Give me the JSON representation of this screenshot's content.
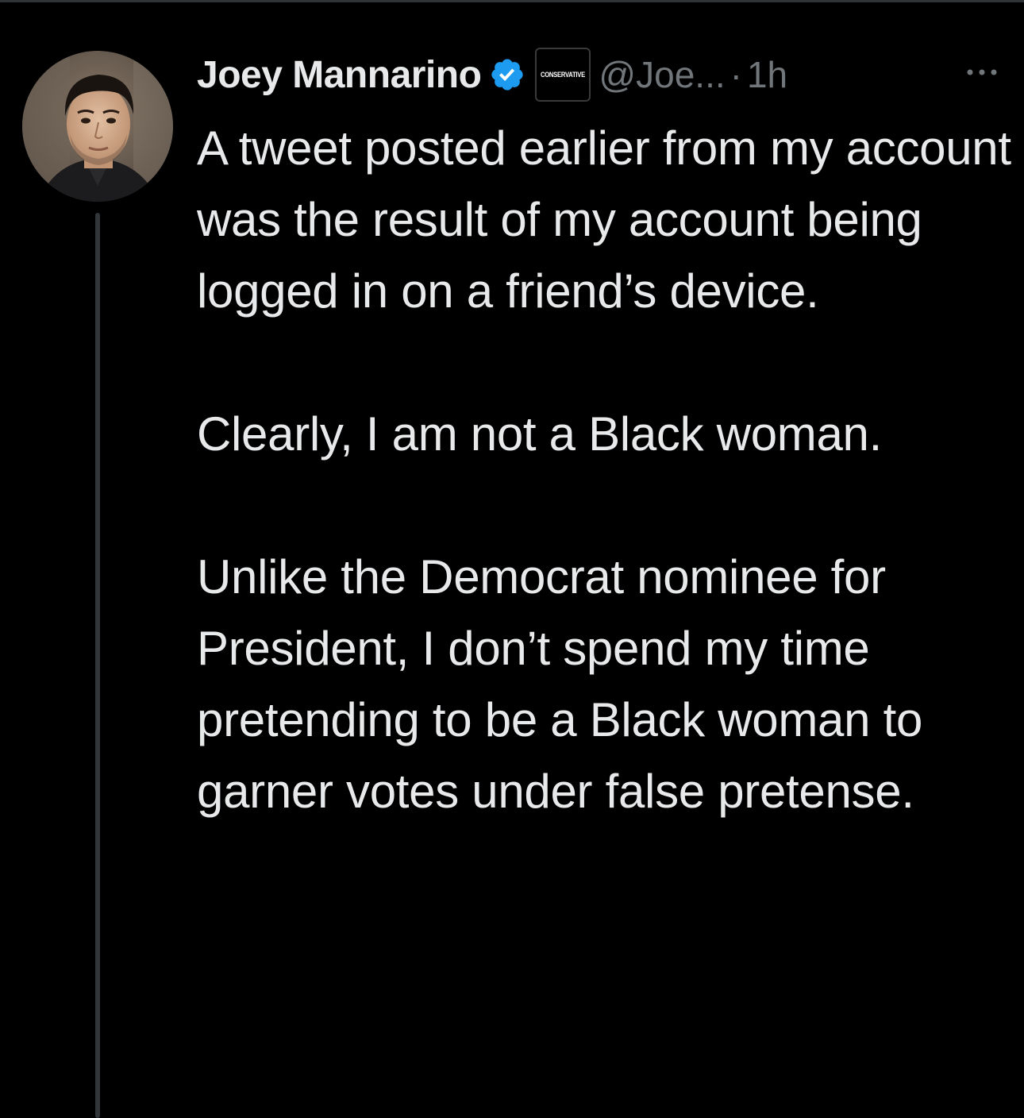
{
  "tweet": {
    "display_name": "Joey Mannarino",
    "affiliation_badge": "CONSERVATIVE",
    "handle": "@Joe...",
    "separator": "·",
    "timestamp": "1h",
    "paragraphs": [
      "A tweet posted earlier from my account was the result of my account being logged in on a friend’s device.",
      "Clearly, I am not a Black woman.",
      "Unlike the Democrat nominee for President, I don’t spend my time pretending to be a Black woman to garner votes under false pretense."
    ]
  },
  "icons": {
    "verified": "verified-badge-icon",
    "more": "more-options-icon",
    "avatar": "profile-avatar"
  },
  "colors": {
    "background": "#000000",
    "text_primary": "#e7e9ea",
    "text_secondary": "#71767b",
    "verified_blue": "#1d9bf0",
    "thread_line": "#333639"
  }
}
